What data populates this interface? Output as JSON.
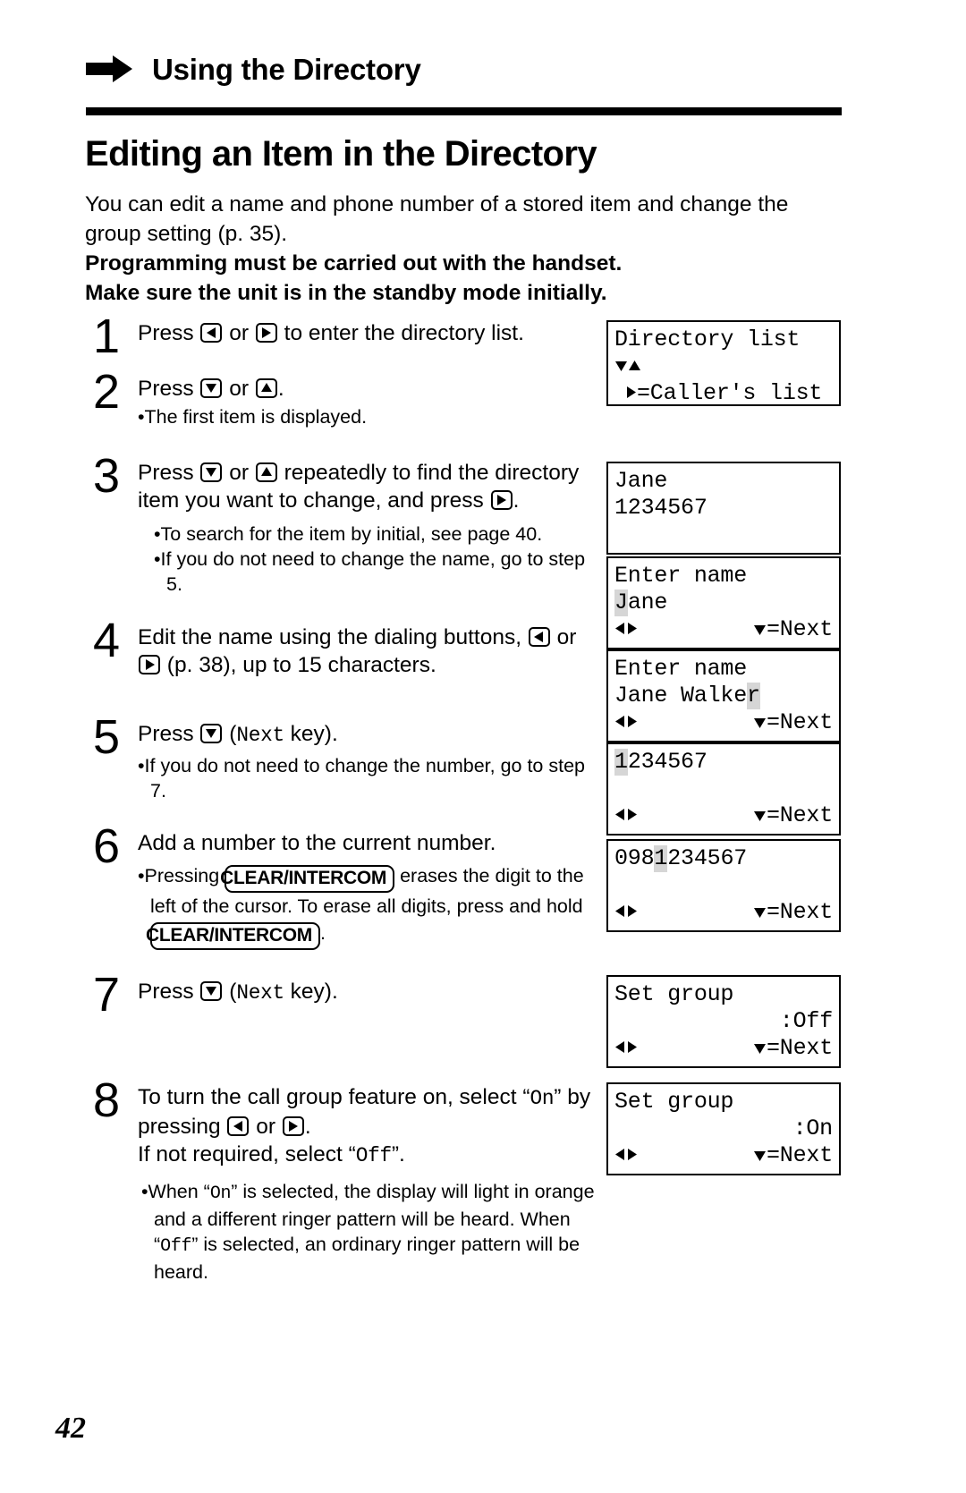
{
  "header": {
    "bullet_icon": "right-arrow-bullet",
    "title": "Using the Directory"
  },
  "main_title": "Editing an Item in the Directory",
  "intro": {
    "line1": "You can edit a name and phone number of a stored item and change the",
    "line2": "group setting (p. 35).",
    "bold1": "Programming must be carried out with the handset.",
    "bold2": "Make sure the unit is in the standby mode initially."
  },
  "steps": [
    {
      "num": "1",
      "t1": "Press ",
      "key1": "left-arrow-key",
      "t2": " or ",
      "key2": "right-arrow-key",
      "t3": " to enter the directory list."
    },
    {
      "num": "2",
      "t1": "Press ",
      "key1": "down-arrow-key",
      "t2": " or ",
      "key2": "up-arrow-key",
      "t3": ".",
      "sub": "The first item is displayed."
    },
    {
      "num": "3",
      "t1": "Press ",
      "key1": "down-arrow-key",
      "t2": " or ",
      "key2": "up-arrow-key",
      "t3": " repeatedly to find the directory item you want to change, and press ",
      "key3": "right-arrow-key",
      "t4": ".",
      "sub1": "To search for the item by initial, see page 40.",
      "sub2": "If you do not need to change the name, go to step 5."
    },
    {
      "num": "4",
      "t1": "Edit the name using the dialing buttons, ",
      "key1": "left-arrow-key",
      "t2": " or ",
      "key2": "right-arrow-key",
      "t3": " (p. 38), up to 15 characters."
    },
    {
      "num": "5",
      "t1": "Press ",
      "key1": "down-arrow-key",
      "t2": " (",
      "mono1": "Next",
      "t3": " key).",
      "sub1": "If you do not need to change the number, go to step 7."
    },
    {
      "num": "6",
      "t1": "Add a number to the current number.",
      "sub_a": "Pressing ",
      "hardkey1": "CLEAR/INTERCOM",
      "sub_b": " erases the digit to the left of the cursor. To erase all digits, press and hold ",
      "hardkey2": "CLEAR/INTERCOM",
      "sub_c": "."
    },
    {
      "num": "7",
      "t1": "Press ",
      "key1": "down-arrow-key",
      "t2": " (",
      "mono1": "Next",
      "t3": " key)."
    },
    {
      "num": "8",
      "t1": "To turn the call group feature on, select “",
      "mono1": "On",
      "t2": "” by pressing ",
      "key1": "left-arrow-key",
      "t3": " or ",
      "key2": "right-arrow-key",
      "t4": ".",
      "t5": "If not required, select “",
      "mono2": "Off",
      "t6": "”.",
      "sub_a": "When “",
      "sub_mono1": "On",
      "sub_b": "” is selected, the display will light in orange and a different ringer pattern will be heard. When “",
      "sub_mono2": "Off",
      "sub_c": "” is selected, an ordinary ringer pattern will be heard."
    }
  ],
  "lcds": [
    {
      "id": "lcd-directory-list",
      "row1": "Directory list",
      "row2_icons": "down-triangle up-triangle",
      "row3_icon": "right-triangle",
      "row3": "=Caller's list"
    },
    {
      "id": "lcd-jane-entry",
      "row1": "Jane",
      "row2": "1234567"
    },
    {
      "id": "lcd-enter-name-jane",
      "row1": "Enter name",
      "row2_hl": "J",
      "row2_rest": "ane",
      "row3_left_icons": "left-triangle right-triangle",
      "row3_right_icon": "down-triangle",
      "row3_right": "=Next"
    },
    {
      "id": "lcd-enter-name-jane-walker",
      "row1": "Enter name",
      "row2_pre": "Jane Walke",
      "row2_hl": "r",
      "row3_left_icons": "left-triangle right-triangle",
      "row3_right_icon": "down-triangle",
      "row3_right": "=Next"
    },
    {
      "id": "lcd-number-1234567",
      "row1_hl": "1",
      "row1_rest": "234567",
      "row3_left_icons": "left-triangle right-triangle",
      "row3_right_icon": "down-triangle",
      "row3_right": "=Next"
    },
    {
      "id": "lcd-number-0981234567",
      "row1_pre": "098",
      "row1_hl": "1",
      "row1_rest": "234567",
      "row3_left_icons": "left-triangle right-triangle",
      "row3_right_icon": "down-triangle",
      "row3_right": "=Next"
    },
    {
      "id": "lcd-set-group-off",
      "row1": "Set group",
      "row2_right": ":Off",
      "row3_left_icons": "left-triangle right-triangle",
      "row3_right_icon": "down-triangle",
      "row3_right": "=Next"
    },
    {
      "id": "lcd-set-group-on",
      "row1": "Set group",
      "row2_right": ":On",
      "row3_left_icons": "left-triangle right-triangle",
      "row3_right_icon": "down-triangle",
      "row3_right": "=Next"
    }
  ],
  "page_number": "42",
  "colors": {
    "ink": "#000000",
    "paper": "#ffffff",
    "highlight": "#d6d6d6"
  }
}
